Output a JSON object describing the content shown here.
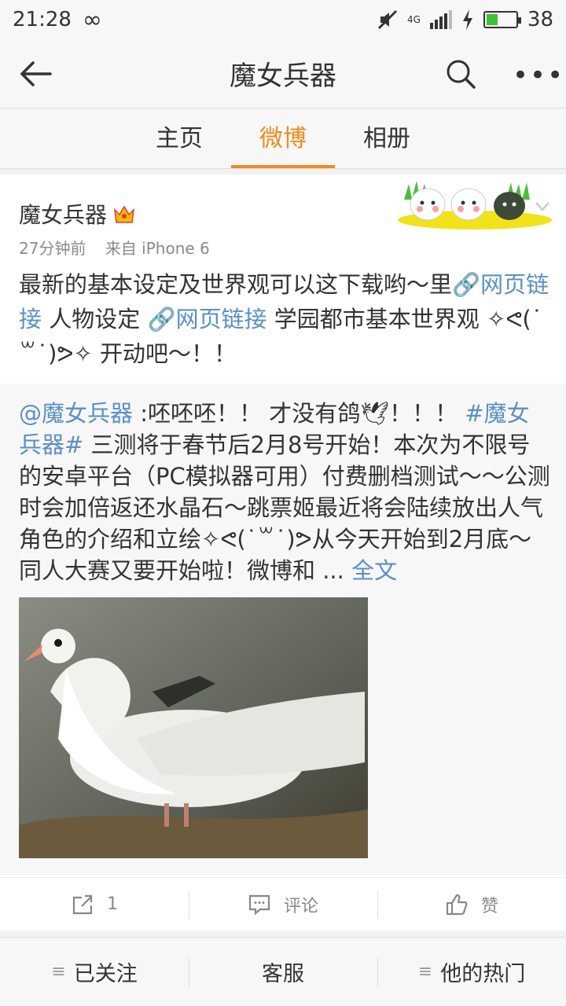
{
  "status": {
    "time": "21:28",
    "battery": "38",
    "network": "4G",
    "battery_fill_percent": 38
  },
  "header": {
    "title": "魔女兵器"
  },
  "tabs": [
    {
      "label": "主页",
      "active": false
    },
    {
      "label": "微博",
      "active": true
    },
    {
      "label": "相册",
      "active": false
    }
  ],
  "post": {
    "author": "魔女兵器",
    "time_ago": "27分钟前",
    "source": "来自 iPhone 6",
    "text_1": "最新的基本设定及世界观可以这下载哟～里",
    "link_1": "网页链接",
    "text_2": " 人物设定 ",
    "link_2": "网页链接",
    "text_3": " 学园都市基本世界观 ✧ᕙ(˙꒳˙)ᕗ✧ 开动吧～！！"
  },
  "repost": {
    "mention": "@魔女兵器",
    "text_1": " :呸呸呸！！ 才没有鸽",
    "text_2": "！！！ ",
    "hashtag": "#魔女兵器#",
    "text_3": " 三测将于春节后2月8号开始！本次为不限号的安卓平台（PC模拟器可用）付费删档测试～～公测时会加倍返还水晶石～跳票姬最近将会陆续放出人气角色的介绍和立绘✧ᕙ(˙꒳˙)ᕗ从今天开始到2月底～同人大赛又要开始啦！微博和 ...",
    "full_text": " 全文"
  },
  "actions": {
    "repost_count": "1",
    "comment": "评论",
    "like": "赞"
  },
  "bottom": [
    {
      "label": "已关注"
    },
    {
      "label": "客服"
    },
    {
      "label": "他的热门"
    }
  ],
  "colors": {
    "accent": "#f08a1c",
    "link": "#5b8fc7"
  }
}
